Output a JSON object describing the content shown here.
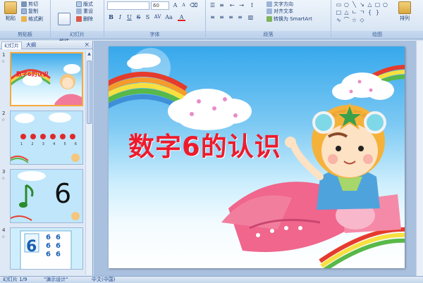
{
  "ribbon": {
    "clipboard": {
      "label": "剪贴板",
      "paste": "粘贴",
      "cut": "剪切",
      "copy": "复制",
      "format_painter": "格式刷"
    },
    "slides": {
      "label": "幻灯片",
      "new_slide": "新建\n幻灯片",
      "layout": "版式",
      "reset": "重设",
      "delete": "删除"
    },
    "font": {
      "label": "字体",
      "font_name": "",
      "font_size": "60"
    },
    "paragraph": {
      "label": "段落",
      "text_direction": "文字方向",
      "align_text": "对齐文本",
      "smartart": "转换为 SmartArt"
    },
    "drawing": {
      "label": "绘图",
      "arrange": "排列"
    }
  },
  "panel": {
    "tabs": [
      "幻灯片",
      "大纲"
    ],
    "close": "×",
    "slides": [
      {
        "num": "1",
        "anim": "☆"
      },
      {
        "num": "2",
        "anim": "☆",
        "digits": [
          "1",
          "2",
          "3",
          "4",
          "5",
          "6"
        ]
      },
      {
        "num": "3",
        "anim": "☆",
        "digit": "6"
      },
      {
        "num": "4",
        "anim": "☆",
        "digit": "6",
        "grid_digit": "6"
      }
    ]
  },
  "slide": {
    "title": "数字6的认识"
  },
  "status": {
    "slide_info": "幻灯片 1/9",
    "theme": "\"演示设计\"",
    "language": "中文(中国)"
  },
  "colors": {
    "title": "#ee1b2d",
    "selection": "#f3a93e",
    "ribbon_bg": "#dbe7f5"
  }
}
